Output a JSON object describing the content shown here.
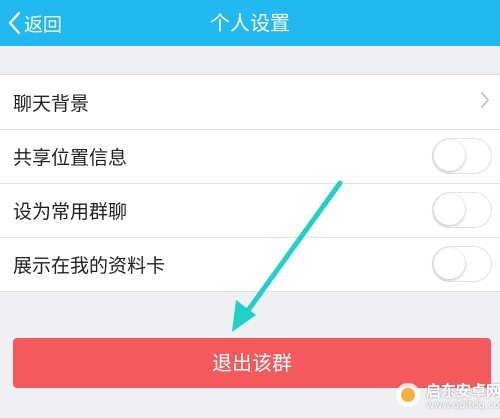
{
  "navbar": {
    "back_label": "返回",
    "title": "个人设置"
  },
  "settings": [
    {
      "label": "聊天背景",
      "control": "chevron"
    },
    {
      "label": "共享位置信息",
      "control": "toggle",
      "on": false
    },
    {
      "label": "设为常用群聊",
      "control": "toggle",
      "on": false
    },
    {
      "label": "展示在我的资料卡",
      "control": "toggle",
      "on": false
    }
  ],
  "exit_button": {
    "label": "退出该群"
  },
  "watermark": {
    "main": "启东安卓网",
    "sub": "www.qdltdq.com"
  },
  "colors": {
    "navbar": "#22b8f0",
    "exit_button": "#f45a5b",
    "annotation_arrow": "#1fd1c8"
  },
  "icons": {
    "back": "chevron-left-icon",
    "row_disclosure": "chevron-right-icon",
    "annotation": "arrow-icon"
  }
}
